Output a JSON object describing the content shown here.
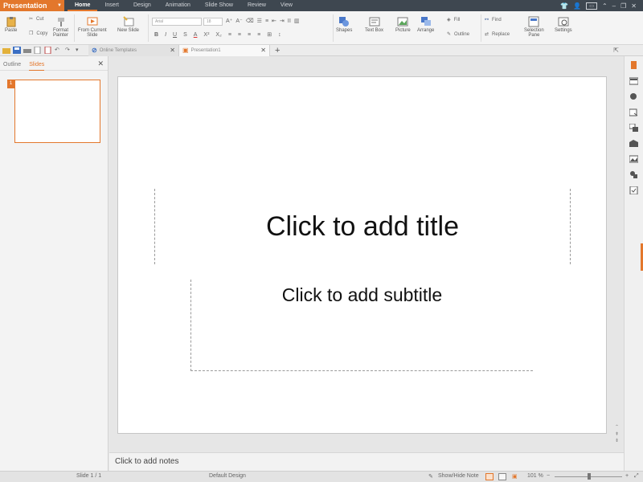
{
  "app": {
    "name": "Presentation",
    "menu_tabs": [
      "Home",
      "Insert",
      "Design",
      "Animation",
      "Slide Show",
      "Review",
      "View"
    ],
    "active_tab": "Home"
  },
  "ribbon": {
    "paste": "Paste",
    "cut": "Cut",
    "copy": "Copy",
    "format_painter_1": "Format",
    "format_painter_2": "Painter",
    "from_current_1": "From Current",
    "from_current_2": "Slide",
    "new_slide": "New Slide",
    "font_name": "Arial",
    "font_size": "18",
    "shapes": "Shapes",
    "text_box": "Text Box",
    "picture": "Picture",
    "arrange": "Arrange",
    "fill": "Fill",
    "outline": "Outline",
    "find": "Find",
    "replace": "Replace",
    "selection_pane_1": "Selection",
    "selection_pane_2": "Pane",
    "settings": "Settings"
  },
  "doc_tabs": {
    "templates": "Online Templates",
    "presentation": "Presentation1"
  },
  "left_panel": {
    "tab_outline": "Outline",
    "tab_slides": "Slides",
    "slide_number": "1"
  },
  "slide": {
    "title_placeholder": "Click to add title",
    "subtitle_placeholder": "Click to add subtitle"
  },
  "notes": {
    "placeholder": "Click to add notes"
  },
  "status": {
    "slide_counter": "Slide 1 / 1",
    "design": "Default Design",
    "show_hide_note": "Show/Hide Note",
    "zoom": "101 %"
  },
  "colors": {
    "accent": "#e3772c",
    "titlebar": "#3e4750"
  }
}
